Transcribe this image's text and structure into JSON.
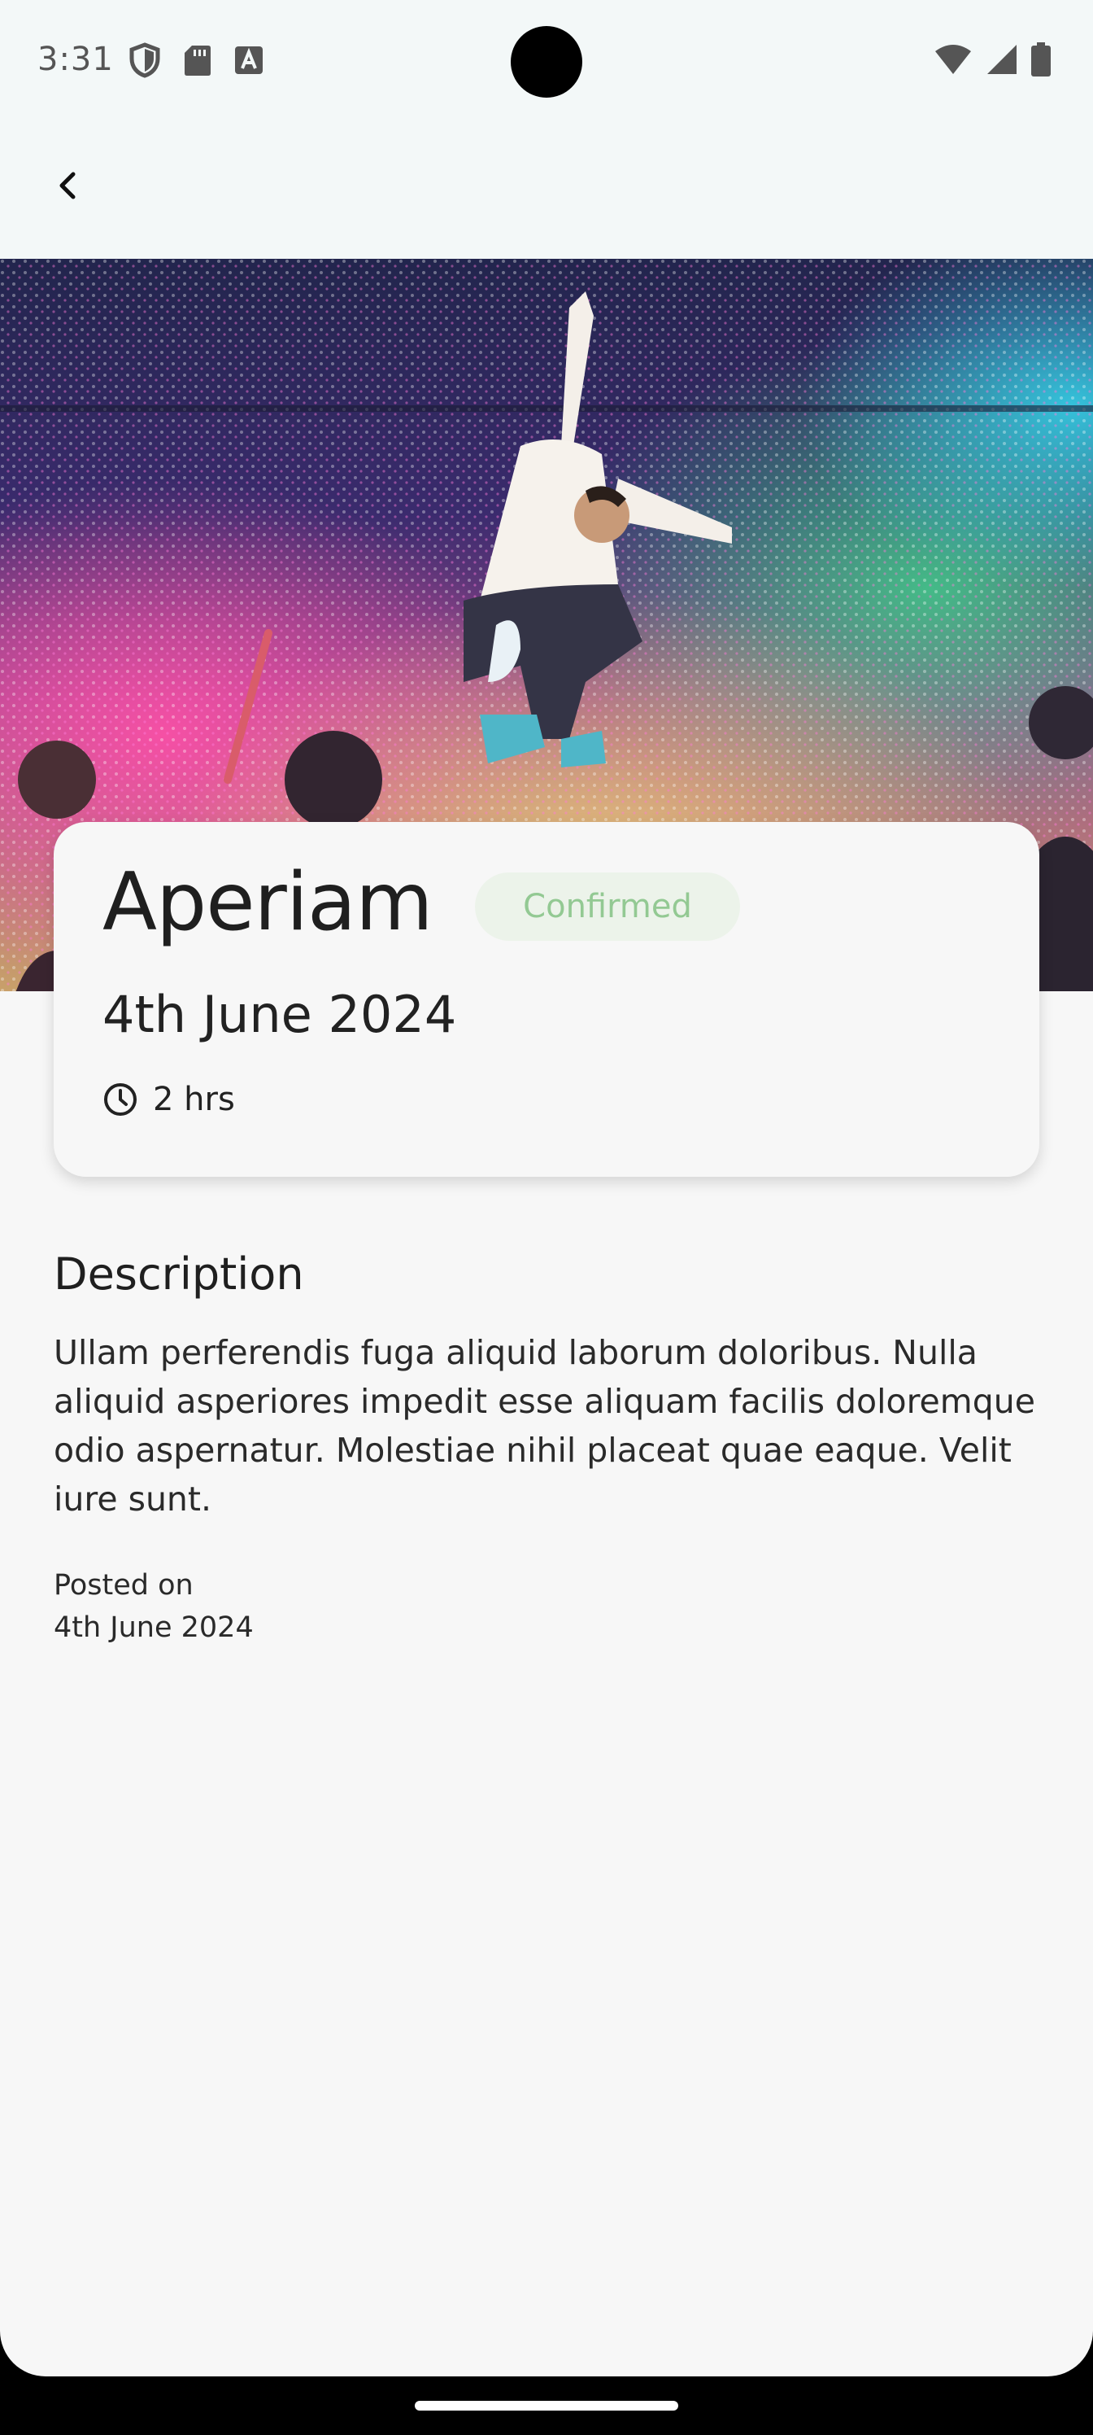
{
  "status_bar": {
    "time": "3:31",
    "left_icons": [
      "shield-icon",
      "sd-card-icon",
      "text-a-icon"
    ],
    "right_icons": [
      "wifi-icon",
      "signal-icon",
      "battery-icon"
    ]
  },
  "nav": {
    "back_icon": "chevron-left-icon"
  },
  "event": {
    "title": "Aperiam",
    "status": "Confirmed",
    "date": "4th June 2024",
    "duration": "2 hrs"
  },
  "description": {
    "heading": "Description",
    "text": "Ullam perferendis fuga aliquid laborum doloribus. Nulla aliquid asperiores impedit esse aliquam facilis doloremque odio aspernatur. Molestiae nihil placeat quae eaque. Velit iure sunt."
  },
  "posted": {
    "label": "Posted on",
    "date": "4th June 2024"
  },
  "colors": {
    "status_badge_bg": "#ecf3ea",
    "status_badge_text": "#93c993",
    "background": "#f7f7f7",
    "topbar": "#f3f8f8"
  }
}
